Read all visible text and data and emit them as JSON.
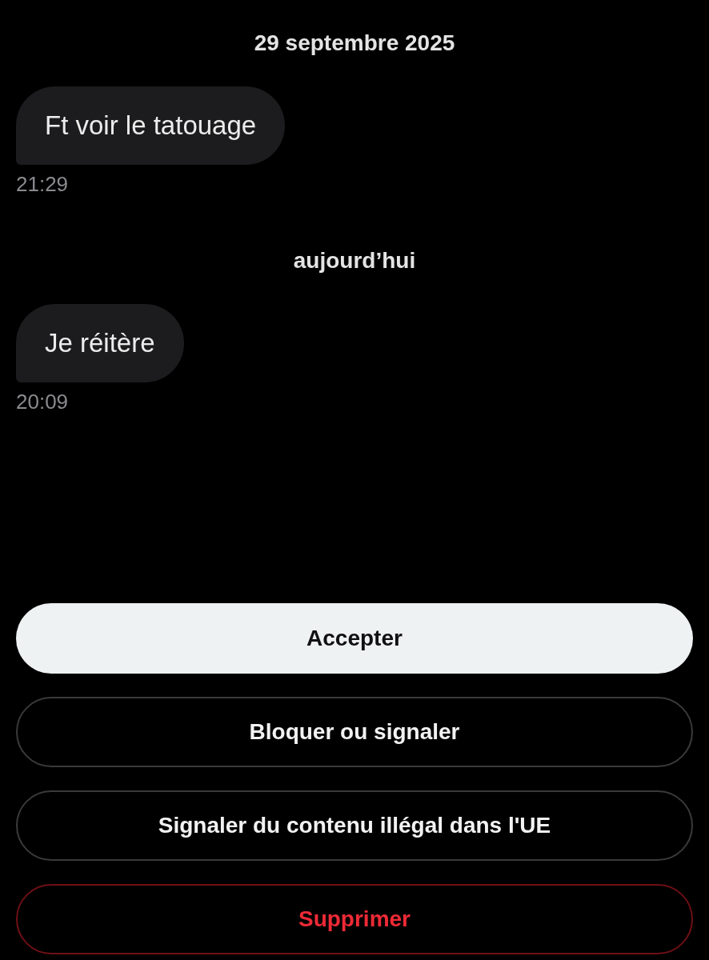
{
  "thread": [
    {
      "kind": "date",
      "text": "29 septembre 2025"
    },
    {
      "kind": "message",
      "text": "Ft voir le tatouage",
      "time": "21:29"
    },
    {
      "kind": "date",
      "text": "aujourd’hui"
    },
    {
      "kind": "message",
      "text": "Je réitère",
      "time": "20:09"
    }
  ],
  "actions": [
    {
      "kind": "primary",
      "label": "Accepter"
    },
    {
      "kind": "outline",
      "label": "Bloquer ou signaler"
    },
    {
      "kind": "outline",
      "label": "Signaler du contenu illégal dans l'UE"
    },
    {
      "kind": "danger",
      "label": "Supprimer"
    }
  ]
}
